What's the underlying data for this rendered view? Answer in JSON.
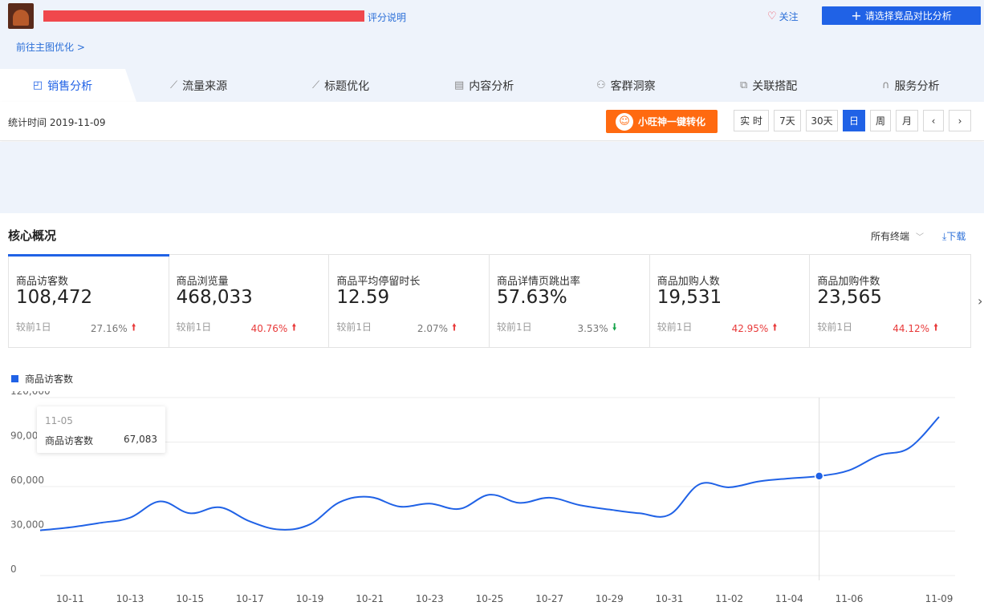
{
  "header": {
    "help_link": "评分说明",
    "follow": "关注",
    "compare_button": "请选择竞品对比分析",
    "goto_link": "前往主图优化 >"
  },
  "tabs": [
    {
      "label": "销售分析",
      "icon": "bag-icon",
      "active": true
    },
    {
      "label": "流量来源",
      "icon": "line-chart-icon",
      "active": false
    },
    {
      "label": "标题优化",
      "icon": "line-chart-icon",
      "active": false
    },
    {
      "label": "内容分析",
      "icon": "document-icon",
      "active": false
    },
    {
      "label": "客群洞察",
      "icon": "users-icon",
      "active": false
    },
    {
      "label": "关联搭配",
      "icon": "link-icon",
      "active": false
    },
    {
      "label": "服务分析",
      "icon": "headset-icon",
      "active": false
    }
  ],
  "statbar": {
    "date_text": "统计时间 2019-11-09",
    "wangwang_button": "小旺神一键转化",
    "periods": [
      {
        "label": "实 时",
        "active": false
      },
      {
        "label": "7天",
        "active": false
      },
      {
        "label": "30天",
        "active": false
      },
      {
        "label": "日",
        "active": true
      },
      {
        "label": "周",
        "active": false
      },
      {
        "label": "月",
        "active": false
      }
    ],
    "prev": "‹",
    "next": "›"
  },
  "overview": {
    "title": "核心概况",
    "terminal": "所有终端",
    "download": "下载",
    "metrics": [
      {
        "label": "商品访客数",
        "value": "108,472",
        "compare": "较前1日",
        "pct": "27.16%",
        "dir": "up",
        "accent": false
      },
      {
        "label": "商品浏览量",
        "value": "468,033",
        "compare": "较前1日",
        "pct": "40.76%",
        "dir": "up",
        "accent": true
      },
      {
        "label": "商品平均停留时长",
        "value": "12.59",
        "compare": "较前1日",
        "pct": "2.07%",
        "dir": "up",
        "accent": false
      },
      {
        "label": "商品详情页跳出率",
        "value": "57.63%",
        "compare": "较前1日",
        "pct": "3.53%",
        "dir": "down",
        "accent": false
      },
      {
        "label": "商品加购人数",
        "value": "19,531",
        "compare": "较前1日",
        "pct": "42.95%",
        "dir": "up",
        "accent": true
      },
      {
        "label": "商品加购件数",
        "value": "23,565",
        "compare": "较前1日",
        "pct": "44.12%",
        "dir": "up",
        "accent": true
      }
    ]
  },
  "colors": {
    "accent": "#2062e6",
    "orange": "#ff6a10",
    "up": "#e83a3a",
    "down": "#16a34a"
  },
  "tooltip": {
    "date": "11-05",
    "name": "商品访客数",
    "value": "67,083"
  },
  "chart_data": {
    "type": "line",
    "series": [
      {
        "name": "商品访客数",
        "values": [
          30500,
          32500,
          35500,
          39000,
          50000,
          42000,
          46000,
          36500,
          31000,
          34500,
          49500,
          53000,
          46500,
          48500,
          45000,
          54500,
          49000,
          52500,
          47500,
          44500,
          42000,
          41000,
          61500,
          59500,
          63500,
          65500,
          67083,
          71000,
          81000,
          86000,
          107000
        ]
      }
    ],
    "x": [
      "10-10",
      "10-11",
      "10-12",
      "10-13",
      "10-14",
      "10-15",
      "10-16",
      "10-17",
      "10-18",
      "10-19",
      "10-20",
      "10-21",
      "10-22",
      "10-23",
      "10-24",
      "10-25",
      "10-26",
      "10-27",
      "10-28",
      "10-29",
      "10-30",
      "10-31",
      "11-01",
      "11-02",
      "11-03",
      "11-04",
      "11-05",
      "11-06",
      "11-07",
      "11-08",
      "11-09"
    ],
    "x_tick_labels": [
      "10-11",
      "10-13",
      "10-15",
      "10-17",
      "10-19",
      "10-21",
      "10-23",
      "10-25",
      "10-27",
      "10-29",
      "10-31",
      "11-02",
      "11-04",
      "11-06",
      "11-09"
    ],
    "y_ticks": [
      "120,000",
      "90,000",
      "60,000",
      "30,000",
      "0"
    ],
    "ylim": [
      0,
      120000
    ],
    "highlight_index": 26,
    "grid": true,
    "legend": "top-left"
  }
}
